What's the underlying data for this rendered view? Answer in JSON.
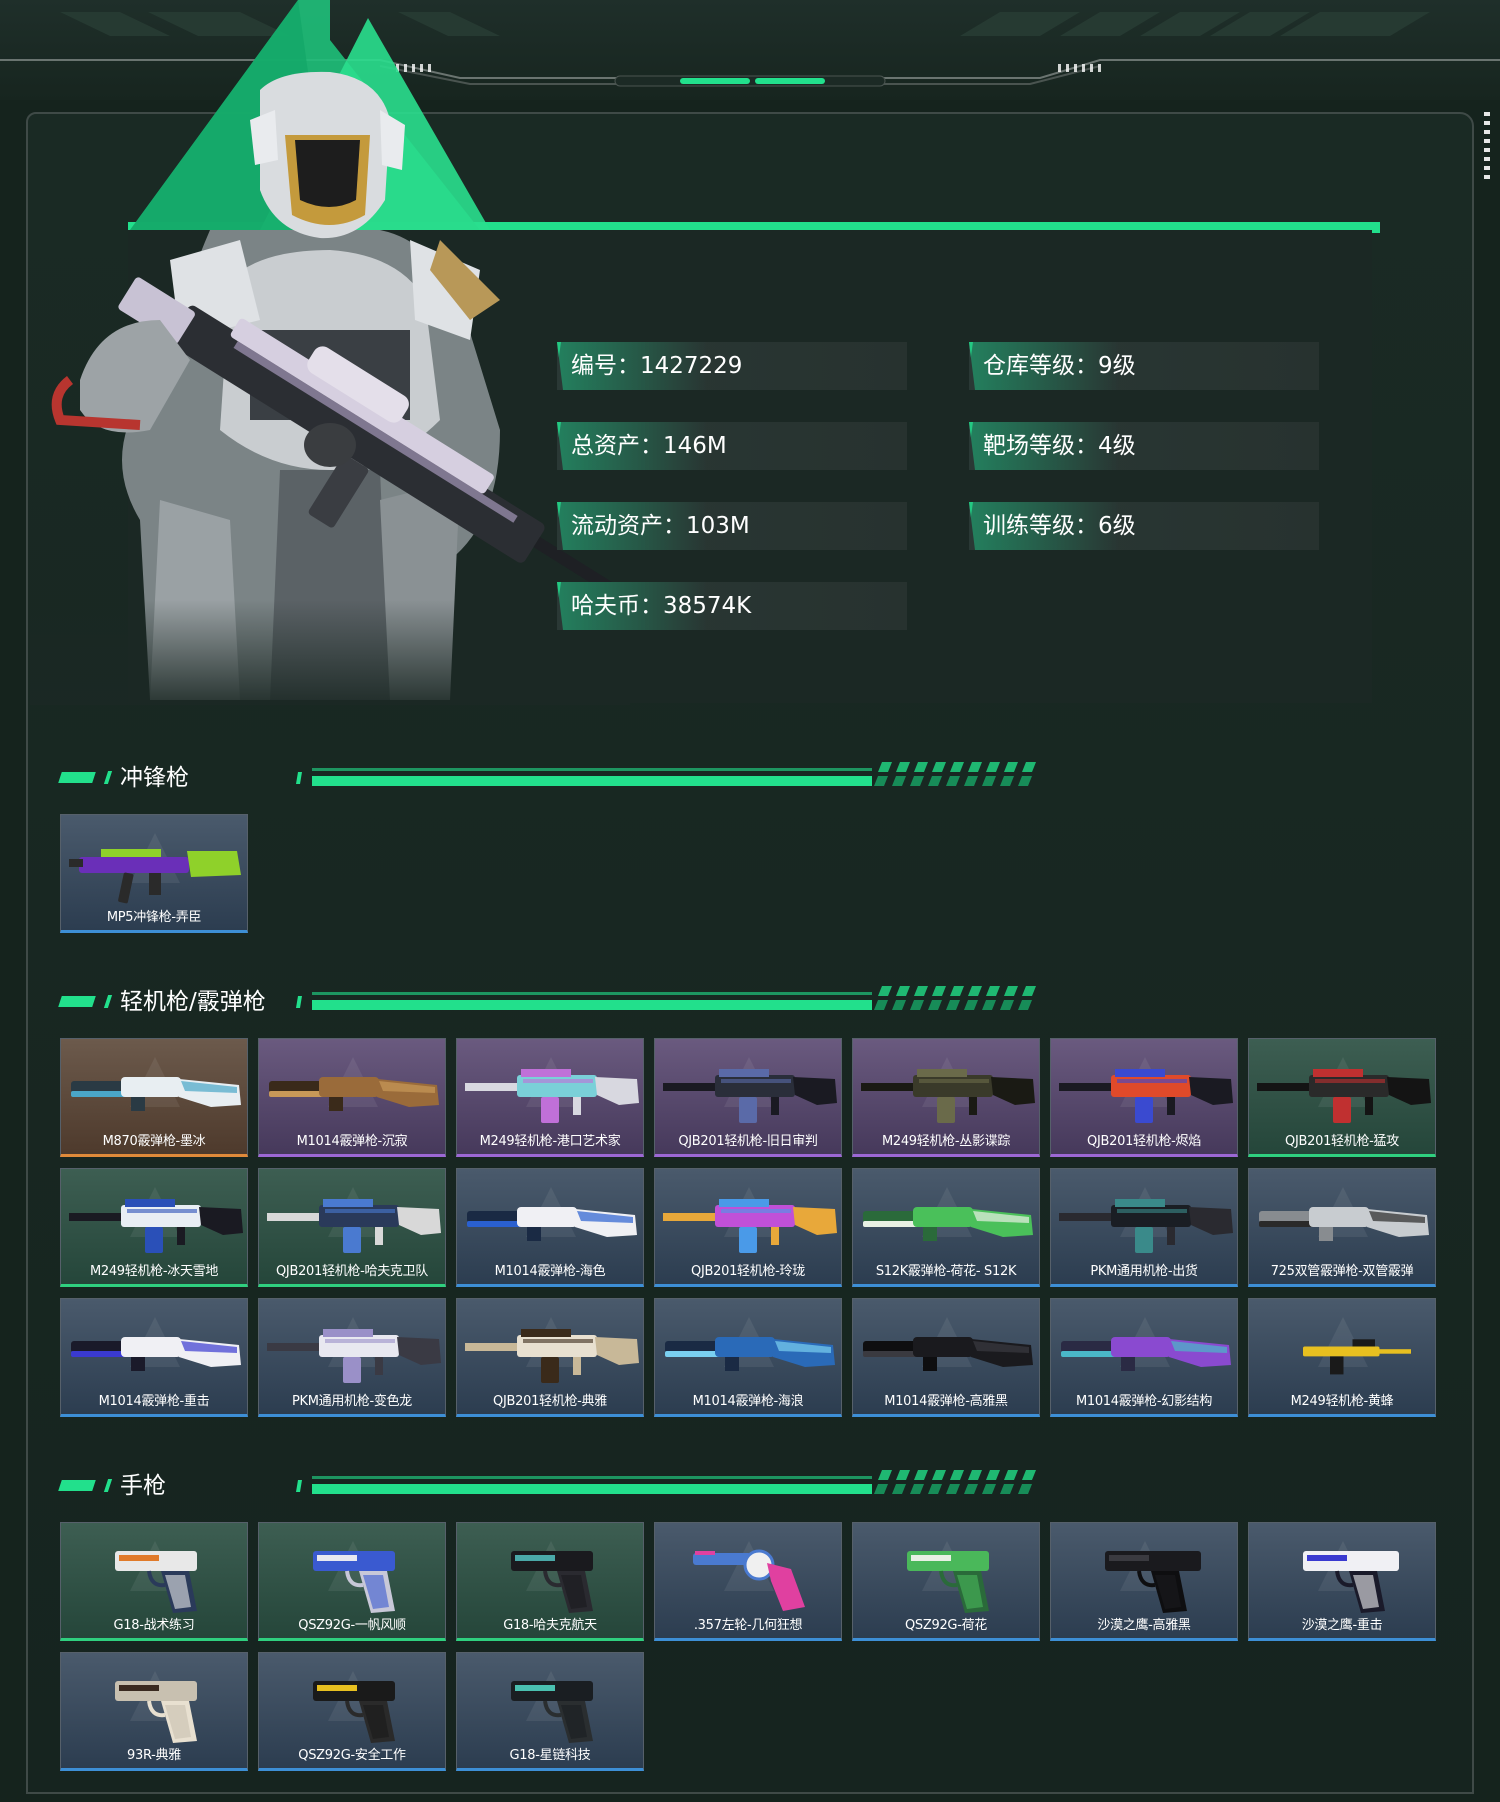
{
  "colors": {
    "accent": "#22e08c",
    "background": "#15231d",
    "rarity_blue": "#3d8fd6",
    "rarity_green": "#2fd07f",
    "rarity_purple": "#9c68d4",
    "rarity_orange": "#e08a3a"
  },
  "stats": [
    {
      "text": "编号：1427229"
    },
    {
      "text": "总资产：146M"
    },
    {
      "text": "流动资产：103M"
    },
    {
      "text": "哈夫币：38574K"
    },
    {
      "text": "仓库等级：9级"
    },
    {
      "text": "靶场等级：4级"
    },
    {
      "text": "训练等级：6级"
    }
  ],
  "sections": [
    {
      "title": "冲锋枪",
      "items": [
        {
          "name": "MP5冲锋枪-弄臣",
          "rarity": "blue",
          "icon": "smg-icon",
          "colors": [
            "#8fd12a",
            "#6a2fb8",
            "#2a2a2a"
          ]
        }
      ]
    },
    {
      "title": "轻机枪/霰弹枪",
      "items": [
        {
          "name": "M870霰弹枪-墨冰",
          "rarity": "orange",
          "icon": "shotgun-icon",
          "colors": [
            "#e8eef2",
            "#4aa6c8",
            "#2a3a44"
          ]
        },
        {
          "name": "M1014霰弹枪-沉寂",
          "rarity": "purple",
          "icon": "shotgun-icon",
          "colors": [
            "#9a6b3a",
            "#c89858",
            "#3a2a1a"
          ]
        },
        {
          "name": "M249轻机枪-港口艺术家",
          "rarity": "purple",
          "icon": "lmg-icon",
          "colors": [
            "#7ad0d8",
            "#c070d8",
            "#d8d8e0"
          ]
        },
        {
          "name": "QJB201轻机枪-旧日审判",
          "rarity": "purple",
          "icon": "lmg-icon",
          "colors": [
            "#2a2e3a",
            "#5a6aa8",
            "#1a1a22"
          ]
        },
        {
          "name": "M249轻机枪-丛影谍踪",
          "rarity": "purple",
          "icon": "lmg-icon",
          "colors": [
            "#3a3a2a",
            "#6a6a4a",
            "#1a1a14"
          ]
        },
        {
          "name": "QJB201轻机枪-烬焰",
          "rarity": "purple",
          "icon": "lmg-icon",
          "colors": [
            "#e04a2a",
            "#3a4ad0",
            "#1a1a22"
          ]
        },
        {
          "name": "QJB201轻机枪-猛攻",
          "rarity": "green",
          "icon": "lmg-icon",
          "colors": [
            "#2a2a2a",
            "#c03030",
            "#141414"
          ]
        },
        {
          "name": "M249轻机枪-冰天雪地",
          "rarity": "green",
          "icon": "lmg-icon",
          "colors": [
            "#e8eef4",
            "#2a50b8",
            "#1a1a22"
          ]
        },
        {
          "name": "QJB201轻机枪-哈夫克卫队",
          "rarity": "green",
          "icon": "lmg-icon",
          "colors": [
            "#2a3a5a",
            "#4a7ad0",
            "#d8d8d8"
          ]
        },
        {
          "name": "M1014霰弹枪-海色",
          "rarity": "blue",
          "icon": "shotgun-icon",
          "colors": [
            "#f0f0f4",
            "#2a60d0",
            "#1a2a44"
          ]
        },
        {
          "name": "QJB201轻机枪-玲珑",
          "rarity": "blue",
          "icon": "lmg-icon",
          "colors": [
            "#c050d8",
            "#4a9ae8",
            "#e8a83a"
          ]
        },
        {
          "name": "S12K霰弹枪-荷花- S12K",
          "rarity": "blue",
          "icon": "shotgun-icon",
          "colors": [
            "#4ac05a",
            "#e8f0e4",
            "#2a6a3a"
          ]
        },
        {
          "name": "PKM通用机枪-出货",
          "rarity": "blue",
          "icon": "lmg-icon",
          "colors": [
            "#1a1e24",
            "#3a8a8a",
            "#2a2a30"
          ]
        },
        {
          "name": "725双管霰弹枪-双管霰弹",
          "rarity": "blue",
          "icon": "shotgun-icon",
          "colors": [
            "#c8ccd0",
            "#2a2a2a",
            "#888c90"
          ]
        },
        {
          "name": "M1014霰弹枪-重击",
          "rarity": "blue",
          "icon": "shotgun-icon",
          "colors": [
            "#f0f0f4",
            "#3a3ad0",
            "#1a1a2a"
          ]
        },
        {
          "name": "PKM通用机枪-变色龙",
          "rarity": "blue",
          "icon": "lmg-icon",
          "colors": [
            "#e8e8f0",
            "#9a90c8",
            "#3a3a44"
          ]
        },
        {
          "name": "QJB201轻机枪-典雅",
          "rarity": "blue",
          "icon": "lmg-icon",
          "colors": [
            "#e8e0d0",
            "#3a2a1a",
            "#c8b898"
          ]
        },
        {
          "name": "M1014霰弹枪-海浪",
          "rarity": "blue",
          "icon": "shotgun-icon",
          "colors": [
            "#2a6ab8",
            "#7ad0f0",
            "#1a2a44"
          ]
        },
        {
          "name": "M1014霰弹枪-高雅黑",
          "rarity": "blue",
          "icon": "shotgun-icon",
          "colors": [
            "#1a1a1e",
            "#3a3a40",
            "#0e0e10"
          ]
        },
        {
          "name": "M1014霰弹枪-幻影结构",
          "rarity": "blue",
          "icon": "shotgun-icon",
          "colors": [
            "#8a4ad0",
            "#4ab8c8",
            "#2a2a44"
          ]
        },
        {
          "name": "M249轻机枪-黄蜂",
          "rarity": "blue",
          "icon": "lmg-small-icon",
          "colors": [
            "#e8c020",
            "#1a1a1a",
            "#e8c020"
          ]
        }
      ]
    },
    {
      "title": "手枪",
      "items": [
        {
          "name": "G18-战术练习",
          "rarity": "green",
          "icon": "pistol-icon",
          "colors": [
            "#e8e8e8",
            "#e07a2a",
            "#2a3a5a"
          ]
        },
        {
          "name": "QSZ92G-一帆风顺",
          "rarity": "green",
          "icon": "pistol-icon",
          "colors": [
            "#3a5ad0",
            "#e8e8f0",
            "#c8c8d8"
          ]
        },
        {
          "name": "G18-哈夫克航天",
          "rarity": "green",
          "icon": "pistol-icon",
          "colors": [
            "#1a1a1e",
            "#4aa8a8",
            "#2a2a30"
          ]
        },
        {
          "name": ".357左轮-几何狂想",
          "rarity": "blue",
          "icon": "revolver-icon",
          "colors": [
            "#e040a0",
            "#4a7ad0",
            "#f0f0f0"
          ]
        },
        {
          "name": "QSZ92G-荷花",
          "rarity": "blue",
          "icon": "pistol-icon",
          "colors": [
            "#4ab85a",
            "#e8f0e4",
            "#2a6a3a"
          ]
        },
        {
          "name": "沙漠之鹰-高雅黑",
          "rarity": "blue",
          "icon": "deagle-icon",
          "colors": [
            "#1a1a1e",
            "#3a3a40",
            "#0e0e10"
          ]
        },
        {
          "name": "沙漠之鹰-重击",
          "rarity": "blue",
          "icon": "deagle-icon",
          "colors": [
            "#f0f0f4",
            "#3a3ad0",
            "#1a1a2a"
          ]
        },
        {
          "name": "93R-典雅",
          "rarity": "blue",
          "icon": "pistol-icon",
          "colors": [
            "#c8c0b0",
            "#3a2a20",
            "#e8e0d0"
          ]
        },
        {
          "name": "QSZ92G-安全工作",
          "rarity": "blue",
          "icon": "pistol-icon",
          "colors": [
            "#1a1a1a",
            "#e8c020",
            "#2a2a2a"
          ]
        },
        {
          "name": "G18-星链科技",
          "rarity": "blue",
          "icon": "pistol-icon",
          "colors": [
            "#1a1e22",
            "#4ac0b0",
            "#2a2e30"
          ]
        }
      ]
    }
  ]
}
